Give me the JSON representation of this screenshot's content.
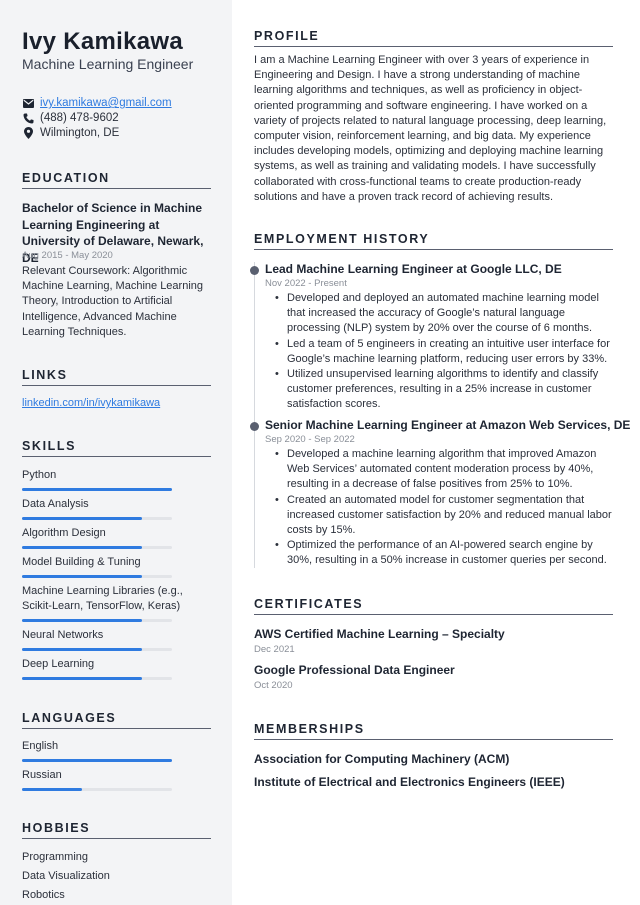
{
  "header": {
    "name": "Ivy Kamikawa",
    "title": "Machine Learning Engineer"
  },
  "contact": {
    "email": "ivy.kamikawa@gmail.com",
    "phone": "(488) 478-9602",
    "location": "Wilmington, DE",
    "icons": [
      "envelope-icon",
      "phone-icon",
      "map-pin-icon"
    ]
  },
  "education": {
    "heading": "EDUCATION",
    "degree": "Bachelor of Science in Machine Learning Engineering at University of Delaware, Newark, DE",
    "date": "Aug 2015 - May 2020",
    "description": "Relevant Coursework: Algorithmic Machine Learning, Machine Learning Theory, Introduction to Artificial Intelligence, Advanced Machine Learning Techniques."
  },
  "links": {
    "heading": "LINKS",
    "items": [
      "linkedin.com/in/ivykamikawa"
    ]
  },
  "skills": {
    "heading": "SKILLS",
    "items": [
      {
        "label": "Python",
        "level": 1.0
      },
      {
        "label": "Data Analysis",
        "level": 0.8
      },
      {
        "label": "Algorithm Design",
        "level": 0.8
      },
      {
        "label": "Model Building & Tuning",
        "level": 0.8
      },
      {
        "label": "Machine Learning Libraries (e.g., Scikit-Learn, TensorFlow, Keras)",
        "level": 0.8
      },
      {
        "label": "Neural Networks",
        "level": 0.8
      },
      {
        "label": "Deep Learning",
        "level": 0.8
      }
    ]
  },
  "languages": {
    "heading": "LANGUAGES",
    "items": [
      {
        "label": "English",
        "level": 1.0
      },
      {
        "label": "Russian",
        "level": 0.4
      }
    ]
  },
  "hobbies": {
    "heading": "HOBBIES",
    "items": [
      "Programming",
      "Data Visualization",
      "Robotics"
    ]
  },
  "profile": {
    "heading": "PROFILE",
    "text": "I am a Machine Learning Engineer with over 3 years of experience in Engineering and Design. I have a strong understanding of machine learning algorithms and techniques, as well as proficiency in object-oriented programming and software engineering. I have worked on a variety of projects related to natural language processing, deep learning, computer vision, reinforcement learning, and big data. My experience includes developing models, optimizing and deploying machine learning systems, as well as training and validating models. I have successfully collaborated with cross-functional teams to create production-ready solutions and have a proven track record of achieving results."
  },
  "employment": {
    "heading": "EMPLOYMENT HISTORY",
    "jobs": [
      {
        "title": "Lead Machine Learning Engineer at Google LLC, DE",
        "date": "Nov 2022 - Present",
        "bullets": [
          "Developed and deployed an automated machine learning model that increased the accuracy of Google’s natural language processing (NLP) system by 20% over the course of 6 months.",
          "Led a team of 5 engineers in creating an intuitive user interface for Google’s machine learning platform, reducing user errors by 33%.",
          "Utilized unsupervised learning algorithms to identify and classify customer preferences, resulting in a 25% increase in customer satisfaction scores."
        ]
      },
      {
        "title": "Senior Machine Learning Engineer at Amazon Web Services, DE",
        "date": "Sep 2020 - Sep 2022",
        "bullets": [
          "Developed a machine learning algorithm that improved Amazon Web Services’ automated content moderation process by 40%, resulting in a decrease of false positives from 25% to 10%.",
          "Created an automated model for customer segmentation that increased customer satisfaction by 20% and reduced manual labor costs by 15%.",
          "Optimized the performance of an AI-powered search engine by 30%, resulting in a 50% increase in customer queries per second."
        ]
      }
    ]
  },
  "certificates": {
    "heading": "CERTIFICATES",
    "items": [
      {
        "title": "AWS Certified Machine Learning – Specialty",
        "date": "Dec 2021"
      },
      {
        "title": "Google Professional Data Engineer",
        "date": "Oct 2020"
      }
    ]
  },
  "memberships": {
    "heading": "MEMBERSHIPS",
    "items": [
      "Association for Computing Machinery (ACM)",
      "Institute of Electrical and Electronics Engineers (IEEE)"
    ]
  },
  "colors": {
    "accent": "#2f7be0",
    "sidebar_bg": "#f3f4f6",
    "heading_rule": "#5a6070",
    "muted_text": "#8a8f98"
  }
}
